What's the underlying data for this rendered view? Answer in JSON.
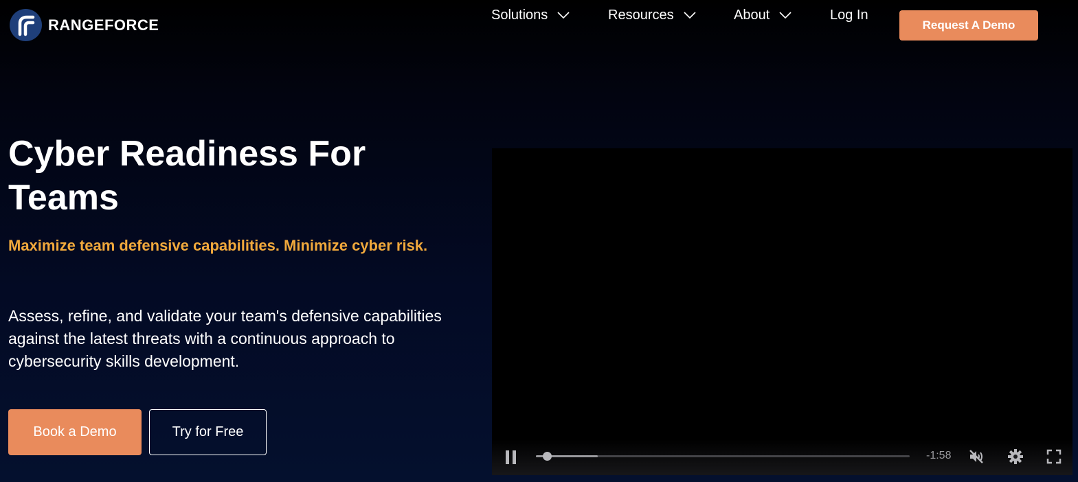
{
  "header": {
    "logo_text": "RANGEFORCE",
    "nav": [
      {
        "label": "Solutions",
        "has_dropdown": true
      },
      {
        "label": "Resources",
        "has_dropdown": true
      },
      {
        "label": "About",
        "has_dropdown": true
      },
      {
        "label": "Log In",
        "has_dropdown": false
      }
    ],
    "cta_label": "Request A Demo"
  },
  "hero": {
    "title": "Cyber Readiness For Teams",
    "tagline": "Maximize team defensive capabilities. Minimize cyber risk.",
    "description": "Assess, refine, and validate your team's defensive capabilities against the latest threats with a continuous approach to cybersecurity skills development.",
    "primary_button": "Book a Demo",
    "secondary_button": "Try for Free"
  },
  "video": {
    "time_remaining": "-1:58",
    "progress_fraction": 0.03,
    "buffered_fraction": 0.165,
    "muted": true,
    "icons": [
      "pause-icon",
      "mute-icon",
      "settings-icon",
      "fullscreen-icon"
    ]
  },
  "colors": {
    "accent": "#e98b5c",
    "tagline": "#f1a93c",
    "logo_bg": "#1f3f7a"
  }
}
